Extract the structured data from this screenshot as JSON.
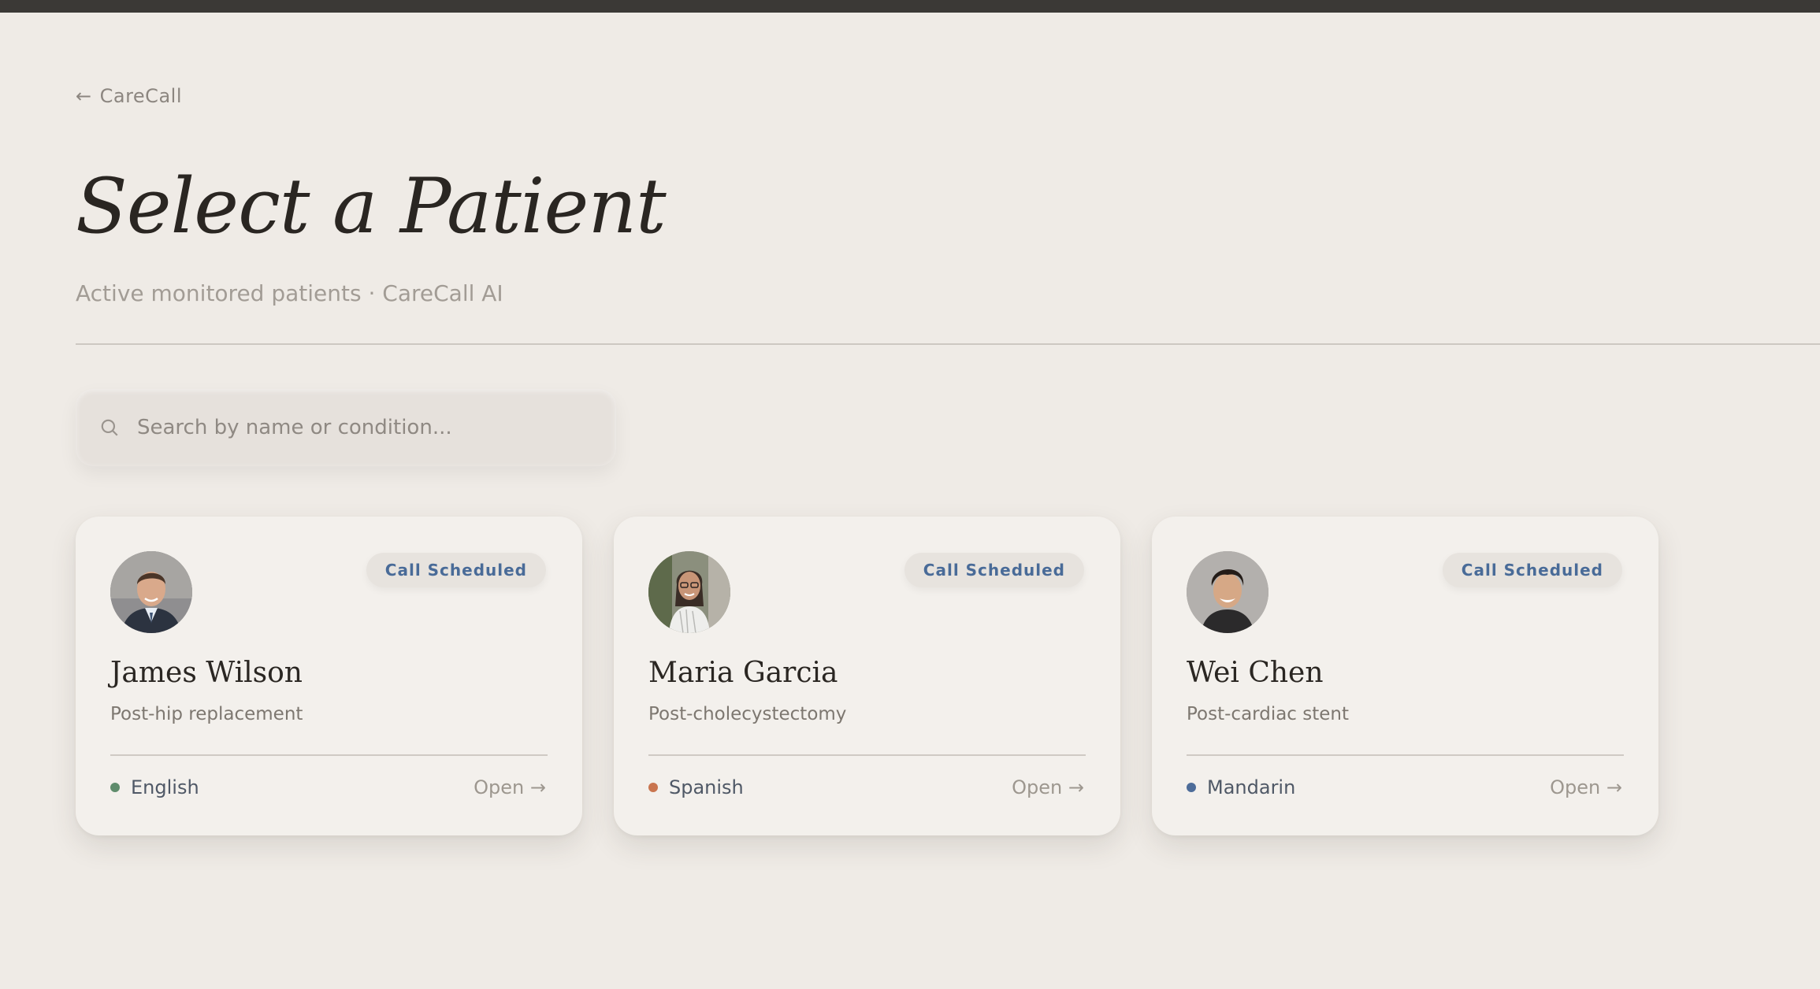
{
  "nav": {
    "back_arrow": "←",
    "back_label": "CareCall"
  },
  "header": {
    "title": "Select a Patient",
    "subtitle": "Active monitored patients · CareCall AI"
  },
  "search": {
    "placeholder": "Search by name or condition...",
    "value": "",
    "icon": "search-icon"
  },
  "patients": [
    {
      "name": "James Wilson",
      "condition": "Post-hip replacement",
      "status": "Call Scheduled",
      "language": "English",
      "language_color": "#5f8c6c",
      "open_label": "Open →",
      "avatar": "avatar-man-suit"
    },
    {
      "name": "Maria Garcia",
      "condition": "Post-cholecystectomy",
      "status": "Call Scheduled",
      "language": "Spanish",
      "language_color": "#c9754f",
      "open_label": "Open →",
      "avatar": "avatar-woman-glasses"
    },
    {
      "name": "Wei Chen",
      "condition": "Post-cardiac stent",
      "status": "Call Scheduled",
      "language": "Mandarin",
      "language_color": "#4d6c99",
      "open_label": "Open →",
      "avatar": "avatar-young-man"
    }
  ],
  "colors": {
    "background": "#efebe6",
    "card": "#f3f0ec",
    "badge_text": "#496b98",
    "top_bar": "#3b3936"
  }
}
